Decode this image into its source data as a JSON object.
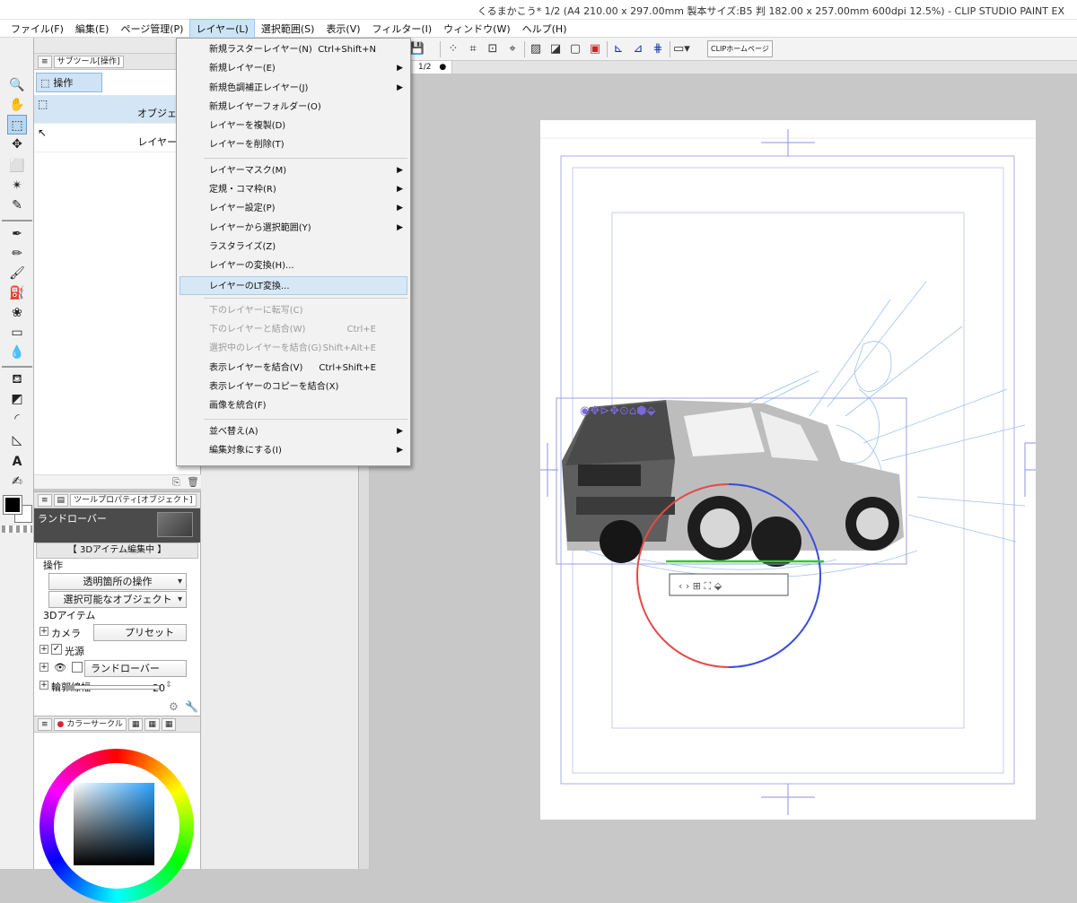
{
  "window": {
    "title": "くるまかこう* 1/2 (A4 210.00 x 297.00mm 製本サイズ:B5 判 182.00 x 257.00mm 600dpi 12.5%) - CLIP STUDIO PAINT EX"
  },
  "menubar": [
    "ファイル(F)",
    "編集(E)",
    "ページ管理(P)",
    "レイヤー(L)",
    "選択範囲(S)",
    "表示(V)",
    "フィルター(I)",
    "ウィンドウ(W)",
    "ヘルプ(H)"
  ],
  "layer_menu": {
    "items": [
      {
        "label": "新規ラスターレイヤー(N)",
        "shortcut": "Ctrl+Shift+N"
      },
      {
        "label": "新規レイヤー(E)",
        "submenu": "▶"
      },
      {
        "label": "新規色調補正レイヤー(J)",
        "submenu": "▶"
      },
      {
        "label": "新規レイヤーフォルダー(O)"
      },
      {
        "label": "レイヤーを複製(D)"
      },
      {
        "label": "レイヤーを削除(T)"
      },
      {
        "label": "レイヤーマスク(M)",
        "submenu": "▶"
      },
      {
        "label": "定規・コマ枠(R)",
        "submenu": "▶"
      },
      {
        "label": "レイヤー設定(P)",
        "submenu": "▶"
      },
      {
        "label": "レイヤーから選択範囲(Y)",
        "submenu": "▶"
      },
      {
        "label": "ラスタライズ(Z)"
      },
      {
        "label": "レイヤーの変換(H)..."
      },
      {
        "label": "レイヤーのLT変換..."
      },
      {
        "label": "下のレイヤーに転写(C)"
      },
      {
        "label": "下のレイヤーと結合(W)",
        "shortcut": "Ctrl+E"
      },
      {
        "label": "選択中のレイヤーを結合(G)",
        "shortcut": "Shift+Alt+E"
      },
      {
        "label": "表示レイヤーを結合(V)",
        "shortcut": "Ctrl+Shift+E"
      },
      {
        "label": "表示レイヤーのコピーを結合(X)"
      },
      {
        "label": "画像を統合(F)"
      },
      {
        "label": "並べ替え(A)",
        "submenu": "▶"
      },
      {
        "label": "編集対象にする(I)",
        "submenu": "▶"
      }
    ]
  },
  "subtool": {
    "tab": "サブツール[操作]",
    "group": "操作",
    "items": [
      "オブジェクト",
      "レイヤー選択"
    ]
  },
  "toolprop": {
    "tab": "ツールプロパティ[オブジェクト]",
    "item_name": "ランドローバー",
    "editing": "【 3Dアイテム編集中 】",
    "section_operation": "操作",
    "transparent_op": "透明箇所の操作",
    "selectable": "選択可能なオブジェクト",
    "section_3d": "3Dアイテム",
    "camera": "カメラ",
    "preset": "プリセット",
    "light": "光源",
    "object": "ランドローバー",
    "outline": "輪郭線幅",
    "outline_value": "20"
  },
  "colorpanel": {
    "tab": "カラーサークル"
  },
  "toolbar": {
    "clip_home": "CLIPホームページ"
  },
  "canvas": {
    "tab": "1/2"
  },
  "colors": {
    "menu_highlight": "#d6e8f6",
    "selection": "#b9d7ee"
  }
}
